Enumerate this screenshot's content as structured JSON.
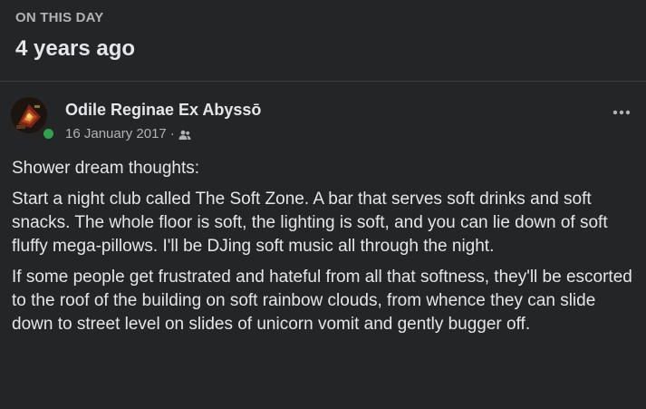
{
  "memory": {
    "eyebrow": "ON THIS DAY",
    "title": "4 years ago"
  },
  "post": {
    "author": "Odile Reginae Ex Abyssō",
    "date": "16 January 2017",
    "separator": "·",
    "audience_icon": "friends-icon",
    "more_icon": "more-horizontal-icon",
    "online_status_color": "#31a24c",
    "paragraphs": [
      "Shower dream thoughts:",
      "Start a night club called The Soft Zone. A bar that serves soft drinks and soft snacks. The whole floor is soft, the lighting is soft, and you can lie down of soft fluffy mega-pillows. I'll be DJing soft music all through the night.",
      "If some people get frustrated and hateful from all that softness, they'll be escorted to the roof of the building on soft rainbow clouds, from whence they can slide down to street level on slides of unicorn vomit and gently bugger off."
    ]
  },
  "theme": {
    "background": "#242526",
    "text_primary": "#e4e6eb",
    "text_secondary": "#b0b3b8",
    "divider": "#3e4042"
  }
}
